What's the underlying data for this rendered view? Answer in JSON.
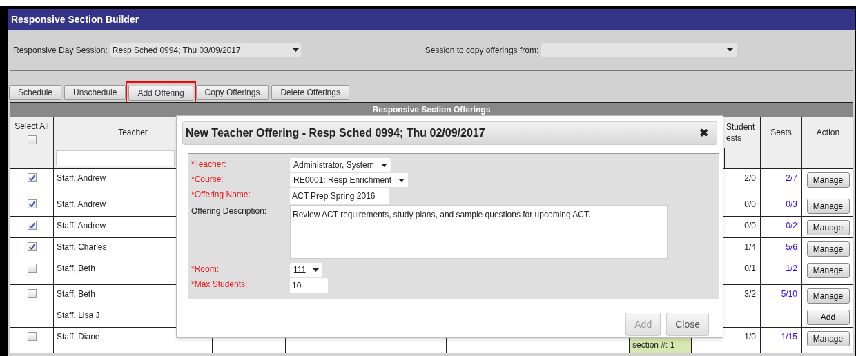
{
  "window": {
    "title": "Responsive Section Builder"
  },
  "session": {
    "label": "Responsive Day Session:",
    "value": "Resp Sched 0994; Thu 03/09/2017"
  },
  "copy_session": {
    "label": "Session to copy offerings from:"
  },
  "toolbar": [
    {
      "label": "Schedule",
      "highlighted": false
    },
    {
      "label": "Unschedule",
      "highlighted": false
    },
    {
      "label": "Add Offering",
      "highlighted": true
    },
    {
      "label": "Copy Offerings",
      "highlighted": false
    },
    {
      "label": "Delete Offerings",
      "highlighted": false
    }
  ],
  "table": {
    "title": "Responsive Section Offerings",
    "select_all": {
      "label": "Select All",
      "checked": false
    },
    "columns": {
      "teacher": "Teacher",
      "students": [
        "Student",
        "ests"
      ],
      "seats": "Seats",
      "action": "Action"
    },
    "rows": [
      {
        "kind": "offering",
        "checked": true,
        "teacher": "Staff, Andrew",
        "students": "2/0",
        "seats": "2/7",
        "action": "Manage"
      },
      {
        "kind": "offering",
        "checked": true,
        "teacher": "Staff, Andrew",
        "students": "0/0",
        "seats": "0/3",
        "action": "Manage"
      },
      {
        "kind": "offering",
        "checked": true,
        "teacher": "Staff, Andrew",
        "students": "0/0",
        "seats": "0/2",
        "action": "Manage"
      },
      {
        "kind": "offering",
        "checked": true,
        "teacher": "Staff, Charles",
        "students": "1/4",
        "seats": "5/6",
        "action": "Manage"
      },
      {
        "kind": "offering",
        "checked": false,
        "teacher": "Staff, Beth",
        "students": "0/1",
        "seats": "1/2",
        "action": "Manage"
      },
      {
        "kind": "offering",
        "checked": false,
        "teacher": "Staff, Beth",
        "students": "3/2",
        "seats": "5/10",
        "action": "Manage"
      },
      {
        "kind": "empty",
        "teacher": "Staff, Lisa J",
        "action": "Add"
      },
      {
        "kind": "offering",
        "checked": false,
        "teacher": "Staff, Diane",
        "section": "section #: 1",
        "students": "1/0",
        "seats": "1/15",
        "action": "Manage"
      }
    ]
  },
  "dialog": {
    "title": "New Teacher Offering - Resp Sched 0994; Thu 02/09/2017",
    "close": "✖",
    "fields": [
      {
        "kind": "select",
        "required": true,
        "label": "*Teacher:",
        "value": "Administrator, System"
      },
      {
        "kind": "select",
        "required": true,
        "label": "*Course:",
        "value": "RE0001: Resp Enrichment"
      },
      {
        "kind": "text",
        "required": true,
        "label": "*Offering Name:",
        "value": "ACT Prep Spring 2016"
      },
      {
        "kind": "textarea",
        "required": false,
        "label": "Offering Description:",
        "value": "Review ACT requirements, study plans, and sample questions for upcoming ACT."
      },
      {
        "kind": "select",
        "required": true,
        "label": "*Room:",
        "value": "111"
      },
      {
        "kind": "text",
        "required": true,
        "label": "*Max Students:",
        "value": "10"
      }
    ],
    "buttons": [
      {
        "label": "Add",
        "disabled": true
      },
      {
        "label": "Close",
        "disabled": false
      }
    ]
  }
}
